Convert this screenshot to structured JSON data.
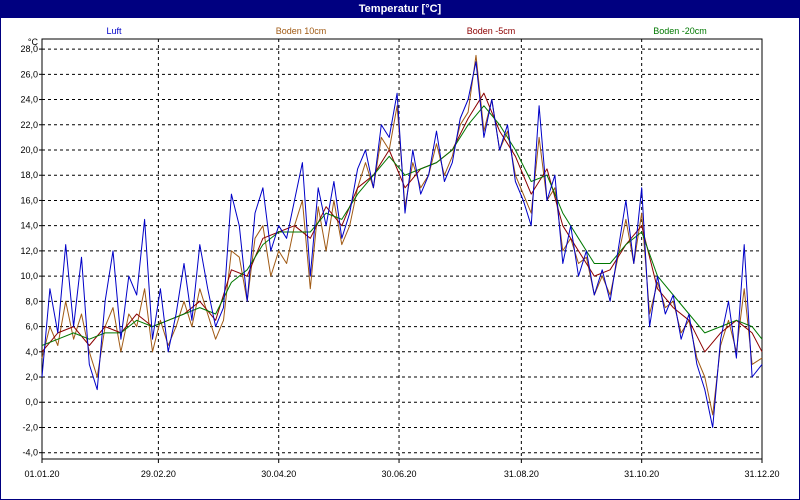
{
  "window": {
    "title": "Temperatur [°C]"
  },
  "colors": {
    "luft": "#0000c8",
    "boden10": "#a05a14",
    "boden5": "#8c0000",
    "boden20": "#007800",
    "grid": "#000000",
    "title_bar": "#000080"
  },
  "chart_data": {
    "type": "line",
    "title": "Temperatur [°C]",
    "ylabel": "°C",
    "xlabel": "",
    "ylim": [
      -4.5,
      28.8
    ],
    "xlim": [
      "2020-01-01",
      "2020-12-31"
    ],
    "grid": true,
    "legend_placement": "top",
    "y_ticks": [
      "-4,0",
      "-2,0",
      "0,0",
      "2,0",
      "4,0",
      "6,0",
      "8,0",
      "10,0",
      "12,0",
      "14,0",
      "16,0",
      "18,0",
      "20,0",
      "22,0",
      "24,0",
      "26,0",
      "28,0"
    ],
    "x_ticks": [
      "01.01.20",
      "29.02.20",
      "30.04.20",
      "30.06.20",
      "31.08.20",
      "31.10.20",
      "31.12.20"
    ],
    "series": [
      {
        "name": "Luft",
        "color_key": "luft",
        "x": [
          "2020-01-01",
          "2020-01-05",
          "2020-01-09",
          "2020-01-13",
          "2020-01-17",
          "2020-01-21",
          "2020-01-25",
          "2020-01-29",
          "2020-02-02",
          "2020-02-06",
          "2020-02-10",
          "2020-02-14",
          "2020-02-18",
          "2020-02-22",
          "2020-02-26",
          "2020-03-01",
          "2020-03-05",
          "2020-03-09",
          "2020-03-13",
          "2020-03-17",
          "2020-03-21",
          "2020-03-25",
          "2020-03-29",
          "2020-04-02",
          "2020-04-06",
          "2020-04-10",
          "2020-04-14",
          "2020-04-18",
          "2020-04-22",
          "2020-04-26",
          "2020-04-30",
          "2020-05-04",
          "2020-05-08",
          "2020-05-12",
          "2020-05-16",
          "2020-05-20",
          "2020-05-24",
          "2020-05-28",
          "2020-06-01",
          "2020-06-05",
          "2020-06-09",
          "2020-06-13",
          "2020-06-17",
          "2020-06-21",
          "2020-06-25",
          "2020-06-29",
          "2020-07-03",
          "2020-07-07",
          "2020-07-11",
          "2020-07-15",
          "2020-07-19",
          "2020-07-23",
          "2020-07-27",
          "2020-07-31",
          "2020-08-04",
          "2020-08-08",
          "2020-08-12",
          "2020-08-16",
          "2020-08-20",
          "2020-08-24",
          "2020-08-28",
          "2020-09-01",
          "2020-09-05",
          "2020-09-09",
          "2020-09-13",
          "2020-09-17",
          "2020-09-21",
          "2020-09-25",
          "2020-09-29",
          "2020-10-03",
          "2020-10-07",
          "2020-10-11",
          "2020-10-15",
          "2020-10-19",
          "2020-10-23",
          "2020-10-27",
          "2020-10-31",
          "2020-11-04",
          "2020-11-08",
          "2020-11-12",
          "2020-11-16",
          "2020-11-20",
          "2020-11-24",
          "2020-11-28",
          "2020-12-02",
          "2020-12-06",
          "2020-12-10",
          "2020-12-14",
          "2020-12-18",
          "2020-12-22",
          "2020-12-26",
          "2020-12-31"
        ],
        "y": [
          2.0,
          9.0,
          5.5,
          12.5,
          6.0,
          11.5,
          3.0,
          1.0,
          8.0,
          12.0,
          5.0,
          10.0,
          8.5,
          14.5,
          5.0,
          9.0,
          4.0,
          7.0,
          11.0,
          6.5,
          12.5,
          9.0,
          6.0,
          7.5,
          16.5,
          14.0,
          8.0,
          15.0,
          17.0,
          12.0,
          14.0,
          13.0,
          16.0,
          19.0,
          10.0,
          17.0,
          14.0,
          17.5,
          13.0,
          15.0,
          18.5,
          20.0,
          17.0,
          22.0,
          21.0,
          24.5,
          15.0,
          20.0,
          16.5,
          18.0,
          21.5,
          17.5,
          19.0,
          22.5,
          24.0,
          27.0,
          21.0,
          24.0,
          20.0,
          22.0,
          17.5,
          16.0,
          14.0,
          23.5,
          16.0,
          18.0,
          11.0,
          14.0,
          10.0,
          12.0,
          8.5,
          10.5,
          8.0,
          12.0,
          16.0,
          11.0,
          17.0,
          6.0,
          10.0,
          7.0,
          8.5,
          5.0,
          7.0,
          3.0,
          1.0,
          -2.0,
          5.0,
          8.0,
          3.5,
          12.5,
          2.0,
          3.0
        ]
      },
      {
        "name": "Boden 10cm",
        "color_key": "boden10",
        "x": [
          "2020-01-01",
          "2020-01-05",
          "2020-01-09",
          "2020-01-13",
          "2020-01-17",
          "2020-01-21",
          "2020-01-25",
          "2020-01-29",
          "2020-02-02",
          "2020-02-06",
          "2020-02-10",
          "2020-02-14",
          "2020-02-18",
          "2020-02-22",
          "2020-02-26",
          "2020-03-01",
          "2020-03-05",
          "2020-03-09",
          "2020-03-13",
          "2020-03-17",
          "2020-03-21",
          "2020-03-25",
          "2020-03-29",
          "2020-04-02",
          "2020-04-06",
          "2020-04-10",
          "2020-04-14",
          "2020-04-18",
          "2020-04-22",
          "2020-04-26",
          "2020-04-30",
          "2020-05-04",
          "2020-05-08",
          "2020-05-12",
          "2020-05-16",
          "2020-05-20",
          "2020-05-24",
          "2020-05-28",
          "2020-06-01",
          "2020-06-05",
          "2020-06-09",
          "2020-06-13",
          "2020-06-17",
          "2020-06-21",
          "2020-06-25",
          "2020-06-29",
          "2020-07-03",
          "2020-07-07",
          "2020-07-11",
          "2020-07-15",
          "2020-07-19",
          "2020-07-23",
          "2020-07-27",
          "2020-07-31",
          "2020-08-04",
          "2020-08-08",
          "2020-08-12",
          "2020-08-16",
          "2020-08-20",
          "2020-08-24",
          "2020-08-28",
          "2020-09-01",
          "2020-09-05",
          "2020-09-09",
          "2020-09-13",
          "2020-09-17",
          "2020-09-21",
          "2020-09-25",
          "2020-09-29",
          "2020-10-03",
          "2020-10-07",
          "2020-10-11",
          "2020-10-15",
          "2020-10-19",
          "2020-10-23",
          "2020-10-27",
          "2020-10-31",
          "2020-11-04",
          "2020-11-08",
          "2020-11-12",
          "2020-11-16",
          "2020-11-20",
          "2020-11-24",
          "2020-11-28",
          "2020-12-02",
          "2020-12-06",
          "2020-12-10",
          "2020-12-14",
          "2020-12-18",
          "2020-12-22",
          "2020-12-26",
          "2020-12-31"
        ],
        "y": [
          3.5,
          6.0,
          4.5,
          8.0,
          5.0,
          7.0,
          4.0,
          2.0,
          6.0,
          7.5,
          4.0,
          7.0,
          6.0,
          9.0,
          4.0,
          6.5,
          4.5,
          6.0,
          8.0,
          6.0,
          9.0,
          7.0,
          5.0,
          6.5,
          12.0,
          11.5,
          8.0,
          13.0,
          14.0,
          10.0,
          12.0,
          11.0,
          14.0,
          16.0,
          9.0,
          15.5,
          12.0,
          16.0,
          12.5,
          14.0,
          17.0,
          19.0,
          17.0,
          21.0,
          20.0,
          23.5,
          15.5,
          19.0,
          17.0,
          18.0,
          20.5,
          18.0,
          19.5,
          22.0,
          23.0,
          27.5,
          21.5,
          24.0,
          20.0,
          21.5,
          18.0,
          16.5,
          15.0,
          21.0,
          16.0,
          17.0,
          12.0,
          13.0,
          11.0,
          11.5,
          8.5,
          10.0,
          8.5,
          11.5,
          14.5,
          11.0,
          15.0,
          7.0,
          9.5,
          7.5,
          8.0,
          5.5,
          6.5,
          3.5,
          2.0,
          -1.0,
          4.5,
          6.5,
          4.0,
          9.0,
          3.0,
          3.5
        ]
      },
      {
        "name": "Boden -5cm",
        "color_key": "boden5",
        "x": [
          "2020-01-01",
          "2020-01-09",
          "2020-01-17",
          "2020-01-25",
          "2020-02-02",
          "2020-02-10",
          "2020-02-18",
          "2020-02-26",
          "2020-03-05",
          "2020-03-13",
          "2020-03-21",
          "2020-03-29",
          "2020-04-06",
          "2020-04-14",
          "2020-04-22",
          "2020-04-30",
          "2020-05-08",
          "2020-05-16",
          "2020-05-24",
          "2020-06-01",
          "2020-06-09",
          "2020-06-17",
          "2020-06-25",
          "2020-07-03",
          "2020-07-11",
          "2020-07-19",
          "2020-07-27",
          "2020-08-04",
          "2020-08-12",
          "2020-08-20",
          "2020-08-28",
          "2020-09-05",
          "2020-09-13",
          "2020-09-21",
          "2020-09-29",
          "2020-10-07",
          "2020-10-15",
          "2020-10-23",
          "2020-10-31",
          "2020-11-08",
          "2020-11-16",
          "2020-11-24",
          "2020-12-02",
          "2020-12-10",
          "2020-12-18",
          "2020-12-26",
          "2020-12-31"
        ],
        "y": [
          4.0,
          5.5,
          6.0,
          4.5,
          6.0,
          5.5,
          7.0,
          6.0,
          6.5,
          7.0,
          8.0,
          6.5,
          10.5,
          10.0,
          13.0,
          13.5,
          14.0,
          13.0,
          15.5,
          14.0,
          17.0,
          18.0,
          20.0,
          17.0,
          18.5,
          19.0,
          20.0,
          22.5,
          24.5,
          21.5,
          19.5,
          16.5,
          18.5,
          14.0,
          12.0,
          10.0,
          10.5,
          12.5,
          14.0,
          9.0,
          7.5,
          6.5,
          4.0,
          5.5,
          6.5,
          5.5,
          4.0
        ]
      },
      {
        "name": "Boden -20cm",
        "color_key": "boden20",
        "x": [
          "2020-01-01",
          "2020-01-09",
          "2020-01-17",
          "2020-01-25",
          "2020-02-02",
          "2020-02-10",
          "2020-02-18",
          "2020-02-26",
          "2020-03-05",
          "2020-03-13",
          "2020-03-21",
          "2020-03-29",
          "2020-04-06",
          "2020-04-14",
          "2020-04-22",
          "2020-04-30",
          "2020-05-08",
          "2020-05-16",
          "2020-05-24",
          "2020-06-01",
          "2020-06-09",
          "2020-06-17",
          "2020-06-25",
          "2020-07-03",
          "2020-07-11",
          "2020-07-19",
          "2020-07-27",
          "2020-08-04",
          "2020-08-12",
          "2020-08-20",
          "2020-08-28",
          "2020-09-05",
          "2020-09-13",
          "2020-09-21",
          "2020-09-29",
          "2020-10-07",
          "2020-10-15",
          "2020-10-23",
          "2020-10-31",
          "2020-11-08",
          "2020-11-16",
          "2020-11-24",
          "2020-12-02",
          "2020-12-10",
          "2020-12-18",
          "2020-12-26",
          "2020-12-31"
        ],
        "y": [
          4.5,
          5.0,
          5.5,
          5.0,
          5.5,
          5.5,
          6.5,
          6.0,
          6.5,
          7.0,
          7.5,
          7.0,
          9.5,
          10.5,
          12.5,
          13.5,
          13.5,
          13.5,
          15.0,
          14.5,
          16.5,
          18.0,
          19.5,
          18.0,
          18.5,
          19.0,
          20.0,
          22.0,
          23.5,
          22.0,
          20.0,
          17.5,
          18.0,
          15.0,
          13.0,
          11.0,
          11.0,
          12.5,
          13.5,
          10.0,
          8.5,
          7.0,
          5.5,
          6.0,
          6.5,
          6.0,
          5.0
        ]
      }
    ]
  }
}
